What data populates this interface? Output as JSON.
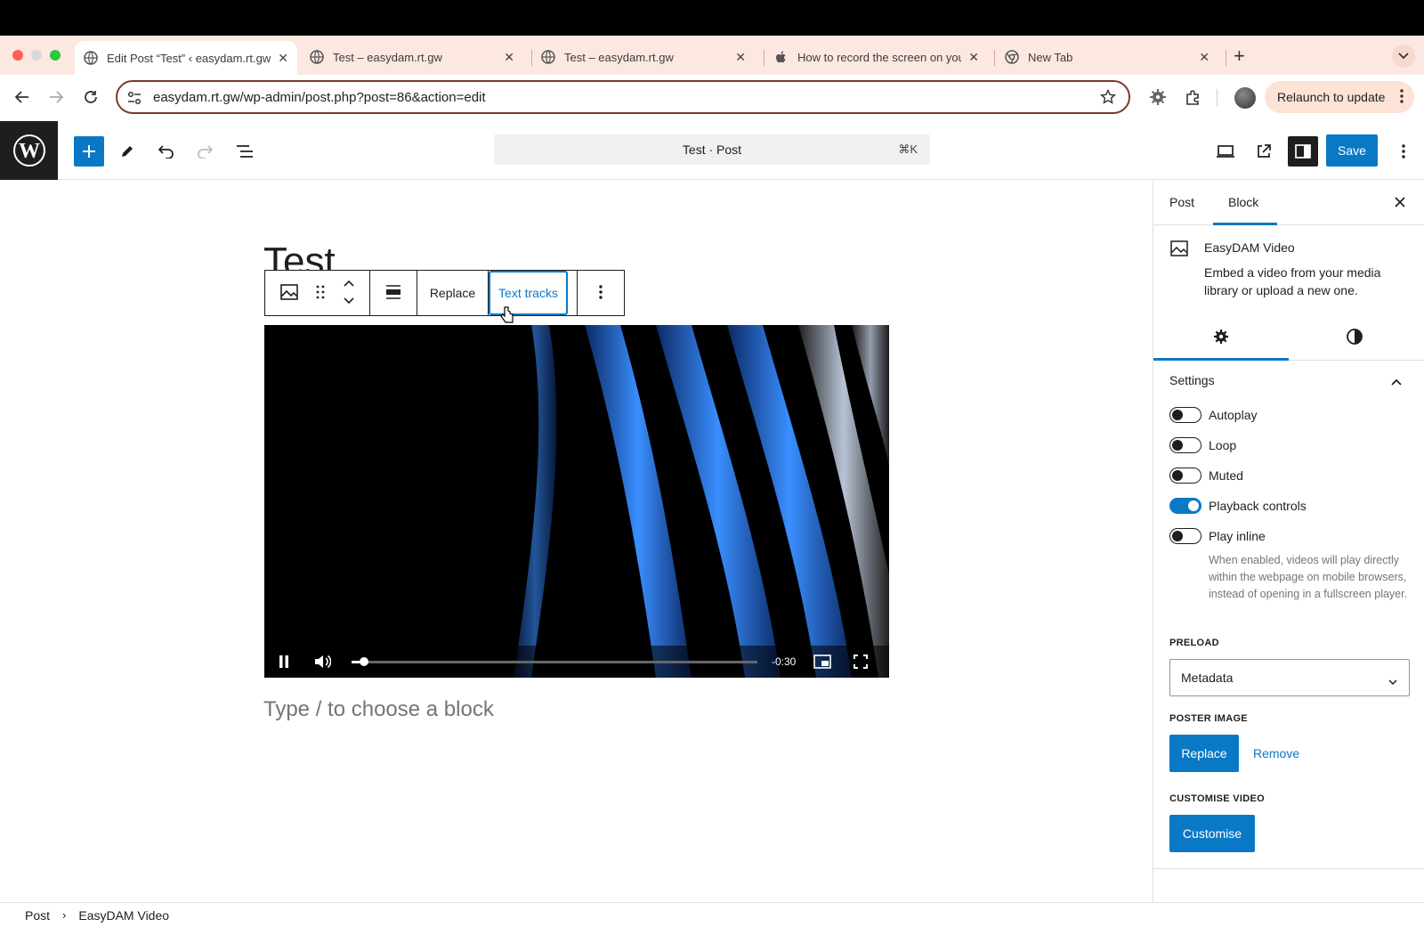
{
  "browser": {
    "tabs": [
      {
        "label": "Edit Post “Test” ‹ easydam.rt.gw",
        "active": true
      },
      {
        "label": "Test – easydam.rt.gw",
        "active": false
      },
      {
        "label": "Test – easydam.rt.gw",
        "active": false
      },
      {
        "label": "How to record the screen on your Mac",
        "active": false
      },
      {
        "label": "New Tab",
        "active": false
      }
    ],
    "url": "easydam.rt.gw/wp-admin/post.php?post=86&action=edit",
    "relaunch_label": "Relaunch to update"
  },
  "wp_toolbar": {
    "command_bar": "Test · Post",
    "shortcut": "⌘K",
    "save_label": "Save"
  },
  "editor": {
    "post_title": "Test",
    "block_toolbar": {
      "replace_label": "Replace",
      "text_tracks_label": "Text tracks"
    },
    "video": {
      "time_remaining": "-0:30",
      "progress": 0.02
    },
    "placeholder": "Type / to choose a block"
  },
  "sidebar": {
    "tabs": [
      "Post",
      "Block"
    ],
    "active_tab": "Block",
    "block_name": "EasyDAM Video",
    "block_description": "Embed a video from your media library or upload a new one.",
    "settings_title": "Settings",
    "toggles": [
      {
        "label": "Autoplay",
        "on": false
      },
      {
        "label": "Loop",
        "on": false
      },
      {
        "label": "Muted",
        "on": false
      },
      {
        "label": "Playback controls",
        "on": true
      },
      {
        "label": "Play inline",
        "on": false
      }
    ],
    "play_inline_help": "When enabled, videos will play directly within the webpage on mobile browsers, instead of opening in a fullscreen player.",
    "preload_label": "PRELOAD",
    "preload_value": "Metadata",
    "poster_label": "POSTER IMAGE",
    "poster_replace": "Replace",
    "poster_remove": "Remove",
    "customise_label": "CUSTOMISE VIDEO",
    "customise_button": "Customise"
  },
  "breadcrumb": [
    "Post",
    "EasyDAM Video"
  ],
  "colors": {
    "accent": "#0a79c5",
    "chrome_bg": "#fde8e1",
    "wp_dark": "#1e1e1e"
  }
}
